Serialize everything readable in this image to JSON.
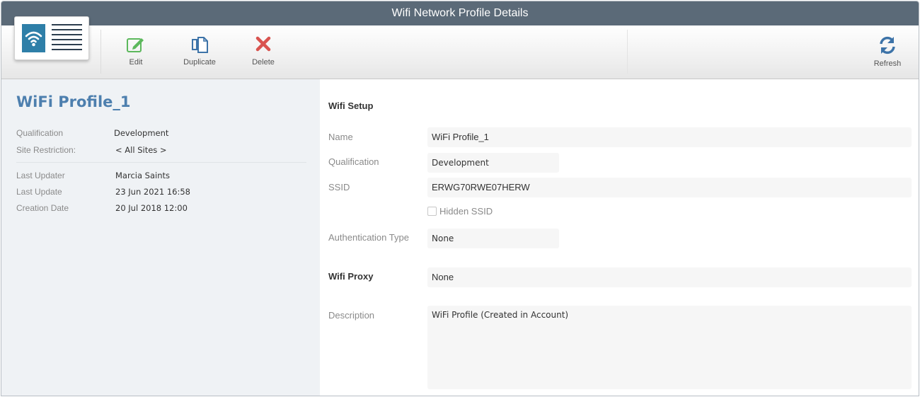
{
  "window": {
    "title": "Wifi Network Profile Details"
  },
  "toolbar": {
    "edit_label": "Edit",
    "duplicate_label": "Duplicate",
    "delete_label": "Delete",
    "refresh_label": "Refresh"
  },
  "colors": {
    "title_bar": "#5b6a78",
    "accent_blue": "#4d7fae",
    "edit_green": "#5cb85c",
    "delete_red": "#d9534f"
  },
  "summary": {
    "profile_name": "WiFi Profile_1",
    "rows": [
      {
        "label": "Qualification",
        "value": "Development"
      },
      {
        "label": "Site Restriction:",
        "value": "< All Sites >"
      },
      {
        "label": "Last Updater",
        "value": "Marcia Saints"
      },
      {
        "label": "Last Update",
        "value": "23 Jun 2021 16:58"
      },
      {
        "label": "Creation Date",
        "value": "20 Jul 2018 12:00"
      }
    ]
  },
  "wifi_setup": {
    "section_title": "Wifi Setup",
    "name_label": "Name",
    "name_value": "WiFi Profile_1",
    "qualification_label": "Qualification",
    "qualification_value": "Development",
    "ssid_label": "SSID",
    "ssid_value": "ERWG70RWE07HERW",
    "hidden_ssid_label": "Hidden SSID",
    "auth_label": "Authentication Type",
    "auth_value": "None"
  },
  "wifi_proxy": {
    "section_title": "Wifi Proxy",
    "value": "None"
  },
  "description": {
    "label": "Description",
    "value": "WiFi Profile (Created in Account)"
  }
}
